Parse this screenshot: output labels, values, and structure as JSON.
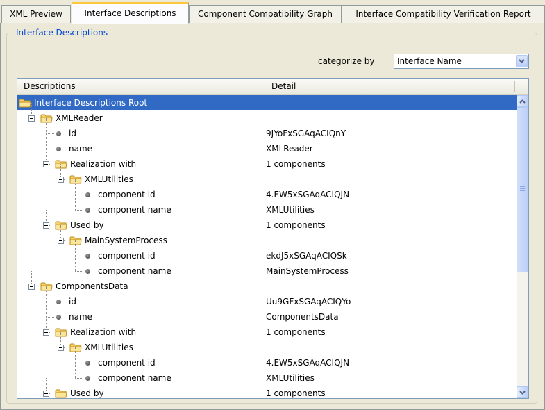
{
  "tabs": [
    {
      "label": "XML Preview",
      "active": false
    },
    {
      "label": "Interface Descriptions",
      "active": true
    },
    {
      "label": "Component Compatibility Graph",
      "active": false
    },
    {
      "label": "Interface Compatibility Verification Report",
      "active": false
    }
  ],
  "group": {
    "title": "Interface Descriptions"
  },
  "categorize": {
    "label": "categorize by",
    "value": "Interface Name"
  },
  "table": {
    "columns": [
      "Descriptions",
      "Detail"
    ],
    "rows": [
      {
        "label": "Interface Descriptions Root",
        "detail": "",
        "type": "folder",
        "selected": true
      },
      {
        "label": "XMLReader",
        "detail": "",
        "type": "folder"
      },
      {
        "label": "id",
        "detail": "9JYoFxSGAqACIQnY",
        "type": "leaf"
      },
      {
        "label": "name",
        "detail": "XMLReader",
        "type": "leaf"
      },
      {
        "label": "Realization with",
        "detail": "1 components",
        "type": "folder"
      },
      {
        "label": "XMLUtilities",
        "detail": "",
        "type": "folder"
      },
      {
        "label": "component id",
        "detail": "4.EW5xSGAqACIQJN",
        "type": "leaf"
      },
      {
        "label": "component name",
        "detail": "XMLUtilities",
        "type": "leaf"
      },
      {
        "label": "Used by",
        "detail": "1 components",
        "type": "folder"
      },
      {
        "label": "MainSystemProcess",
        "detail": "",
        "type": "folder"
      },
      {
        "label": "component id",
        "detail": "ekdJ5xSGAqACIQSk",
        "type": "leaf"
      },
      {
        "label": "component name",
        "detail": "MainSystemProcess",
        "type": "leaf"
      },
      {
        "label": "ComponentsData",
        "detail": "",
        "type": "folder"
      },
      {
        "label": "id",
        "detail": "Uu9GFxSGAqACIQYo",
        "type": "leaf"
      },
      {
        "label": "name",
        "detail": "ComponentsData",
        "type": "leaf"
      },
      {
        "label": "Realization with",
        "detail": "1 components",
        "type": "folder"
      },
      {
        "label": "XMLUtilities",
        "detail": "",
        "type": "folder"
      },
      {
        "label": "component id",
        "detail": "4.EW5xSGAqACIQJN",
        "type": "leaf"
      },
      {
        "label": "component name",
        "detail": "XMLUtilities",
        "type": "leaf"
      },
      {
        "label": "Used by",
        "detail": "1 components",
        "type": "folder"
      }
    ]
  },
  "colors": {
    "selection": "#316ac5",
    "group_title": "#0046d5",
    "active_tab_accent": "#ffc83c"
  },
  "icons": {
    "folder": "folder-icon",
    "leaf": "bullet-icon",
    "dropdown": "chevron-down-icon",
    "scroll_up": "scroll-up-arrow-icon",
    "scroll_down": "scroll-down-arrow-icon"
  }
}
